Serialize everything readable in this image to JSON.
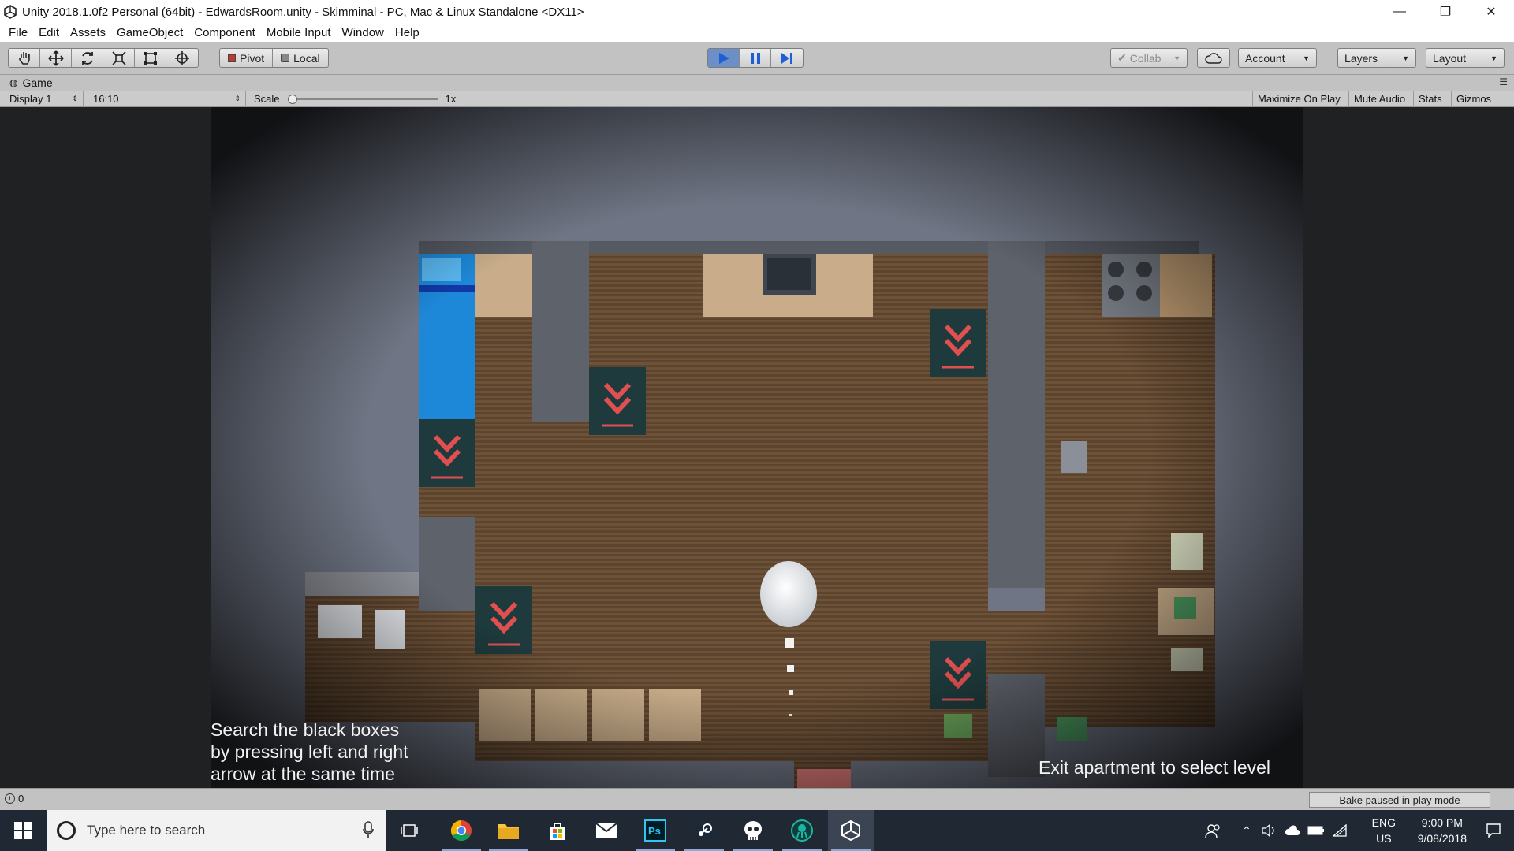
{
  "window": {
    "title": "Unity 2018.1.0f2 Personal (64bit) - EdwardsRoom.unity - Skimminal - PC, Mac & Linux Standalone <DX11>",
    "controls": [
      "minimize",
      "restore",
      "close"
    ]
  },
  "menu": [
    "File",
    "Edit",
    "Assets",
    "GameObject",
    "Component",
    "Mobile Input",
    "Window",
    "Help"
  ],
  "toolbar": {
    "transform_tools": [
      "hand-icon",
      "move-icon",
      "rotate-icon",
      "scale-icon",
      "rect-icon",
      "transform-icon"
    ],
    "pivot_label": "Pivot",
    "local_label": "Local",
    "play_state": "playing",
    "collab_label": "Collab",
    "account_label": "Account",
    "layers_label": "Layers",
    "layout_label": "Layout"
  },
  "game_tab": {
    "title": "Game",
    "display": "Display 1",
    "aspect": "16:10",
    "scale_label": "Scale",
    "scale_value": "1x",
    "options": [
      "Maximize On Play",
      "Mute Audio",
      "Stats",
      "Gizmos"
    ]
  },
  "game": {
    "hint_left_lines": [
      "Search the black boxes",
      "by pressing left and right",
      "arrow at the same time"
    ],
    "hint_right": "Exit apartment to select level"
  },
  "status": {
    "count": "0",
    "bake": "Bake paused in play mode"
  },
  "taskbar": {
    "search_placeholder": "Type here to search",
    "pinned": [
      "task-view-icon",
      "chrome-icon",
      "file-explorer-icon",
      "store-icon",
      "mail-icon",
      "photoshop-icon",
      "steam-icon",
      "skull-app-icon",
      "gitkraken-icon",
      "unity-icon"
    ],
    "lang_top": "ENG",
    "lang_bottom": "US",
    "time": "9:00 PM",
    "date": "9/08/2018"
  }
}
